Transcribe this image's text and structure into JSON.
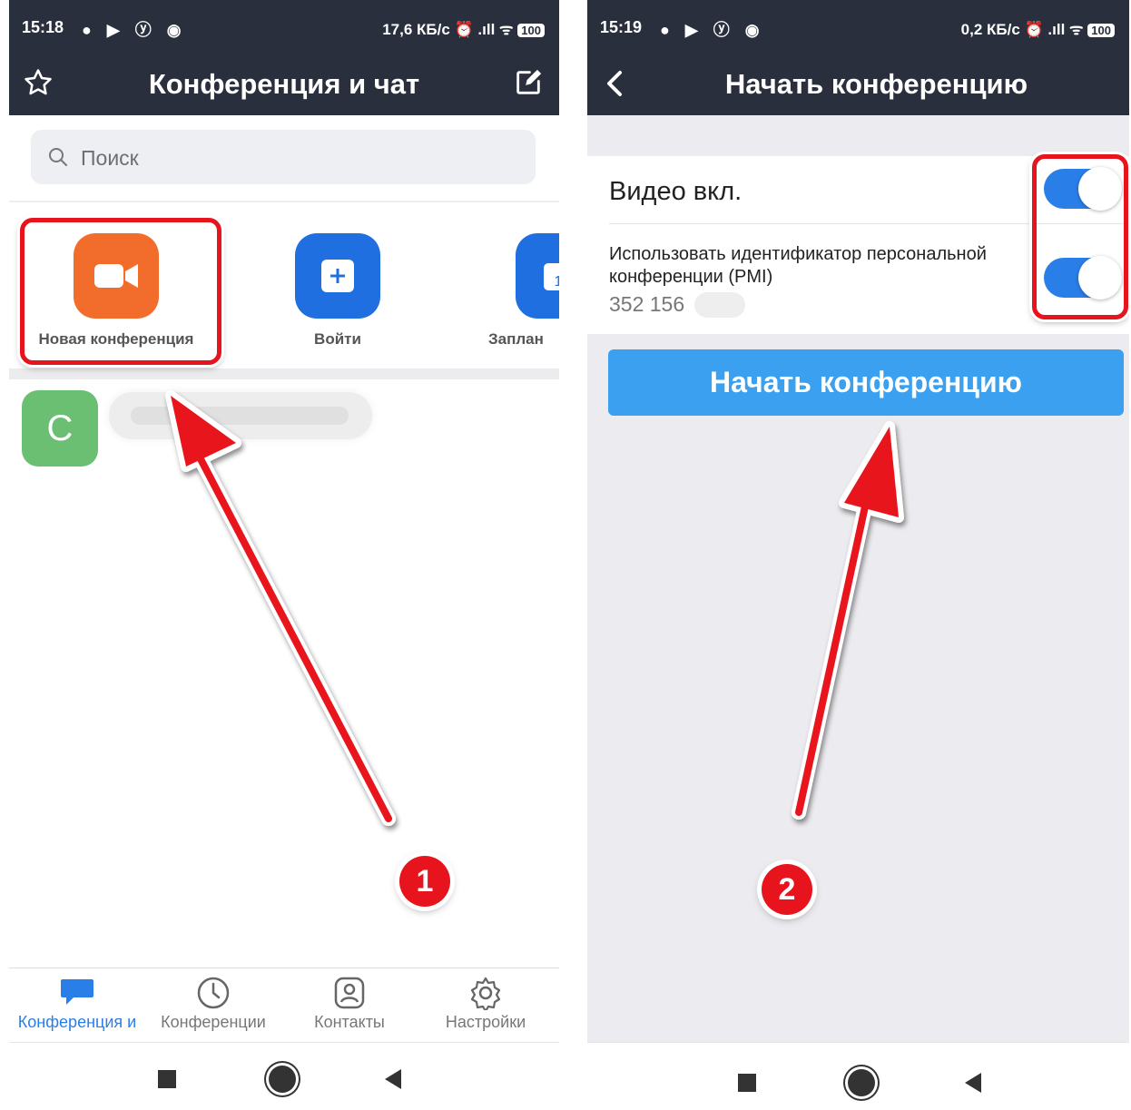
{
  "colors": {
    "appbar": "#2a2f3d",
    "accent_blue": "#2a7ee8",
    "start_button": "#3aa0ef",
    "new_meeting_tile": "#f26d2b",
    "join_tile": "#1f6fe0",
    "avatar": "#6bbf72",
    "annotation_red": "#e8141d"
  },
  "phone1": {
    "status": {
      "time": "15:18",
      "net": "17,6 КБ/с",
      "battery": "100"
    },
    "header": {
      "title": "Конференция и чат",
      "left_icon": "star-icon",
      "right_icon": "edit-icon"
    },
    "search": {
      "placeholder": "Поиск"
    },
    "actions": [
      {
        "label": "Новая конференция",
        "icon": "video-camera-icon"
      },
      {
        "label": "Войти",
        "icon": "plus-icon"
      },
      {
        "label": "Заплан",
        "icon": "calendar-icon"
      }
    ],
    "contact": {
      "initial": "C"
    },
    "tabs": [
      {
        "label": "Конференция и",
        "icon": "chat-bubble-icon",
        "active": true
      },
      {
        "label": "Конференции",
        "icon": "clock-icon",
        "active": false
      },
      {
        "label": "Контакты",
        "icon": "contact-card-icon",
        "active": false
      },
      {
        "label": "Настройки",
        "icon": "gear-icon",
        "active": false
      }
    ],
    "step": "1"
  },
  "phone2": {
    "status": {
      "time": "15:19",
      "net": "0,2 КБ/с",
      "battery": "100"
    },
    "header": {
      "title": "Начать конференцию",
      "back_icon": "chevron-left-icon"
    },
    "video_label": "Видео вкл.",
    "video_on": true,
    "pmi_label": "Использовать идентификатор персональной конференции (PMI)",
    "pmi_number": "352 156",
    "pmi_on": true,
    "start_button": "Начать конференцию",
    "step": "2"
  }
}
